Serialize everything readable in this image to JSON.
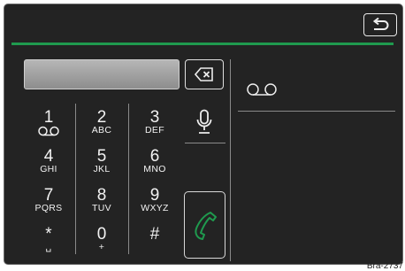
{
  "dialer": {
    "number_value": "",
    "keys": [
      {
        "digit": "1",
        "sub": "",
        "icon": "voicemail-icon"
      },
      {
        "digit": "2",
        "sub": "ABC"
      },
      {
        "digit": "3",
        "sub": "DEF"
      },
      {
        "digit": "4",
        "sub": "GHI"
      },
      {
        "digit": "5",
        "sub": "JKL"
      },
      {
        "digit": "6",
        "sub": "MNO"
      },
      {
        "digit": "7",
        "sub": "PQRS"
      },
      {
        "digit": "8",
        "sub": "TUV"
      },
      {
        "digit": "9",
        "sub": "WXYZ"
      },
      {
        "digit": "*",
        "sub": "␣"
      },
      {
        "digit": "0",
        "sub": "+"
      },
      {
        "digit": "#",
        "sub": ""
      }
    ]
  },
  "right_panel": {
    "icon": "voicemail-icon"
  },
  "colors": {
    "accent": "#1f9a4e",
    "screen_bg": "#232323"
  },
  "figure_label": "Bra-2737"
}
